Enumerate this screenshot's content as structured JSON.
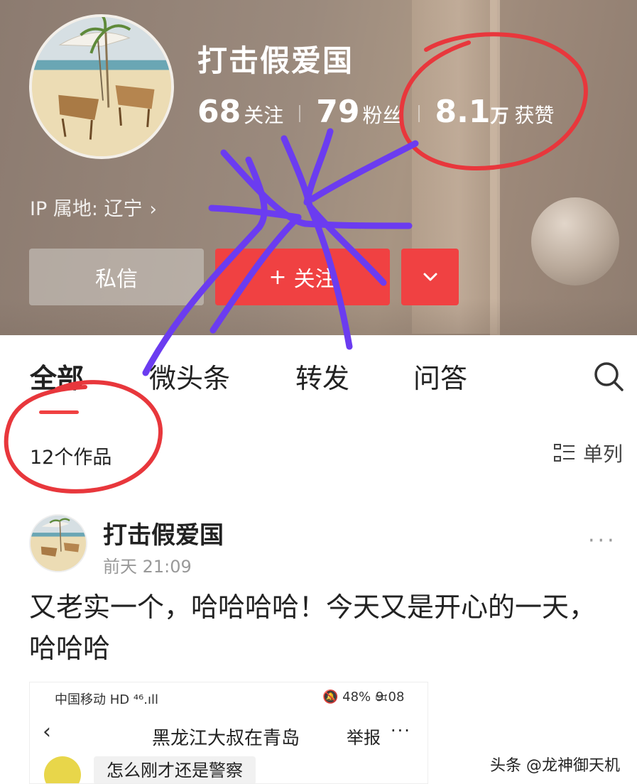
{
  "colors": {
    "accent_red": "#f04142",
    "annotation_red": "#e8373c",
    "annotation_purple": "#6b3cf0"
  },
  "profile": {
    "name": "打击假爱国",
    "stats": [
      {
        "value": "68",
        "unit": "",
        "label": "关注"
      },
      {
        "value": "79",
        "unit": "",
        "label": "粉丝"
      },
      {
        "value": "8.1",
        "unit": "万",
        "label": "获赞"
      }
    ],
    "ip_location": "IP 属地: 辽宁",
    "ip_chevron": "›",
    "buttons": {
      "message": "私信",
      "follow_plus": "+",
      "follow": "关注"
    }
  },
  "tabs": {
    "items": [
      "全部",
      "微头条",
      "转发",
      "问答"
    ],
    "active_index": 0,
    "search_icon": "search-icon"
  },
  "works": {
    "count_label": "12个作品",
    "view_label": "单列",
    "view_icon": "list-icon"
  },
  "post": {
    "author": "打击假爱国",
    "time": "前天 21:09",
    "more": "···",
    "text": "又老实一个，哈哈哈哈！今天又是开心的一天，哈哈哈",
    "embed": {
      "carrier": "中国移动 HD ⁴⁶.ıll",
      "status_right": "🔕 48% ▭",
      "time": "9:08",
      "back": "‹",
      "title": "黑龙江大叔在青岛",
      "report": "举报",
      "dots": "···",
      "chat_message": "怎么刚才还是警察"
    }
  },
  "watermark": "头条 @龙神御天机"
}
